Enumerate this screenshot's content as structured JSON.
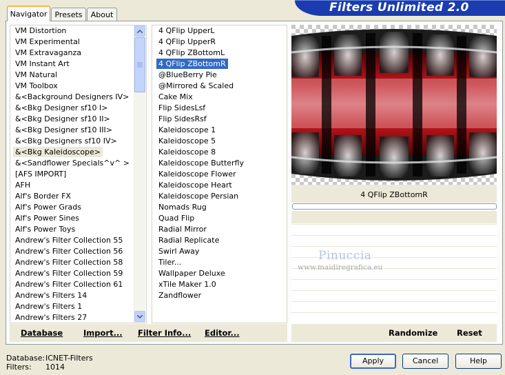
{
  "app": {
    "banner_title": "Filters Unlimited 2.0"
  },
  "tabs": [
    {
      "label": "Navigator",
      "active": true
    },
    {
      "label": "Presets",
      "active": false
    },
    {
      "label": "About",
      "active": false
    }
  ],
  "categories": {
    "items": [
      "VM Distortion",
      "VM Experimental",
      "VM Extravaganza",
      "VM Instant Art",
      "VM Natural",
      "VM Toolbox",
      "&<Background Designers IV>",
      "&<Bkg Designer sf10 I>",
      "&<Bkg Designer sf10 II>",
      "&<Bkg Designer sf10 III>",
      "&<Bkg Designers sf10 IV>",
      "&<Bkg Kaleidoscope>",
      "&<Sandflower Specials^v^ >",
      "[AFS IMPORT]",
      "AFH",
      "Alf's Border FX",
      "Alf's Power Grads",
      "Alf's Power Sines",
      "Alf's Power Toys",
      "Andrew's Filter Collection 55",
      "Andrew's Filter Collection 56",
      "Andrew's Filter Collection 58",
      "Andrew's Filter Collection 59",
      "Andrew's Filter Collection 61",
      "Andrew's Filters 14",
      "Andrew's Filters 1",
      "Andrew's Filters 27"
    ],
    "selected_index": 11
  },
  "filters": {
    "items": [
      "4 QFlip UpperL",
      "4 QFlip UpperR",
      "4 QFlip ZBottomL",
      "4 QFlip ZBottomR",
      "@BlueBerry Pie",
      "@Mirrored & Scaled",
      "Cake Mix",
      "Flip SidesLsf",
      "Flip SidesRsf",
      "Kaleidoscope 1",
      "Kaleidoscope 5",
      "Kaleidoscope 8",
      "Kaleidoscope Butterfly",
      "Kaleidoscope Flower",
      "Kaleidoscope Heart",
      "Kaleidoscope Persian",
      "Nomads Rug",
      "Quad Flip",
      "Radial Mirror",
      "Radial Replicate",
      "Swirl Away",
      "Tiler...",
      "Wallpaper Deluxe",
      "xTile Maker 1.0",
      "Zandflower"
    ],
    "selected_index": 3
  },
  "preview": {
    "filter_name": "4 QFlip ZBottomR",
    "progress": 0,
    "watermark_name": "Pinuccia",
    "watermark_url": "www.maidiregrafica.eu"
  },
  "toolbar": {
    "database": "Database",
    "import": "Import...",
    "filter_info": "Filter Info...",
    "editor": "Editor...",
    "randomize": "Randomize",
    "reset": "Reset"
  },
  "status": {
    "database_label": "Database:",
    "database_value": "ICNET-Filters",
    "filters_label": "Filters:",
    "filters_value": "1014"
  },
  "buttons": {
    "apply": "Apply",
    "cancel": "Cancel",
    "help": "Help"
  },
  "colors": {
    "selection_blue": "#316ac5",
    "banner": "#1a3cae",
    "dialog_bg": "#ece9d8"
  }
}
